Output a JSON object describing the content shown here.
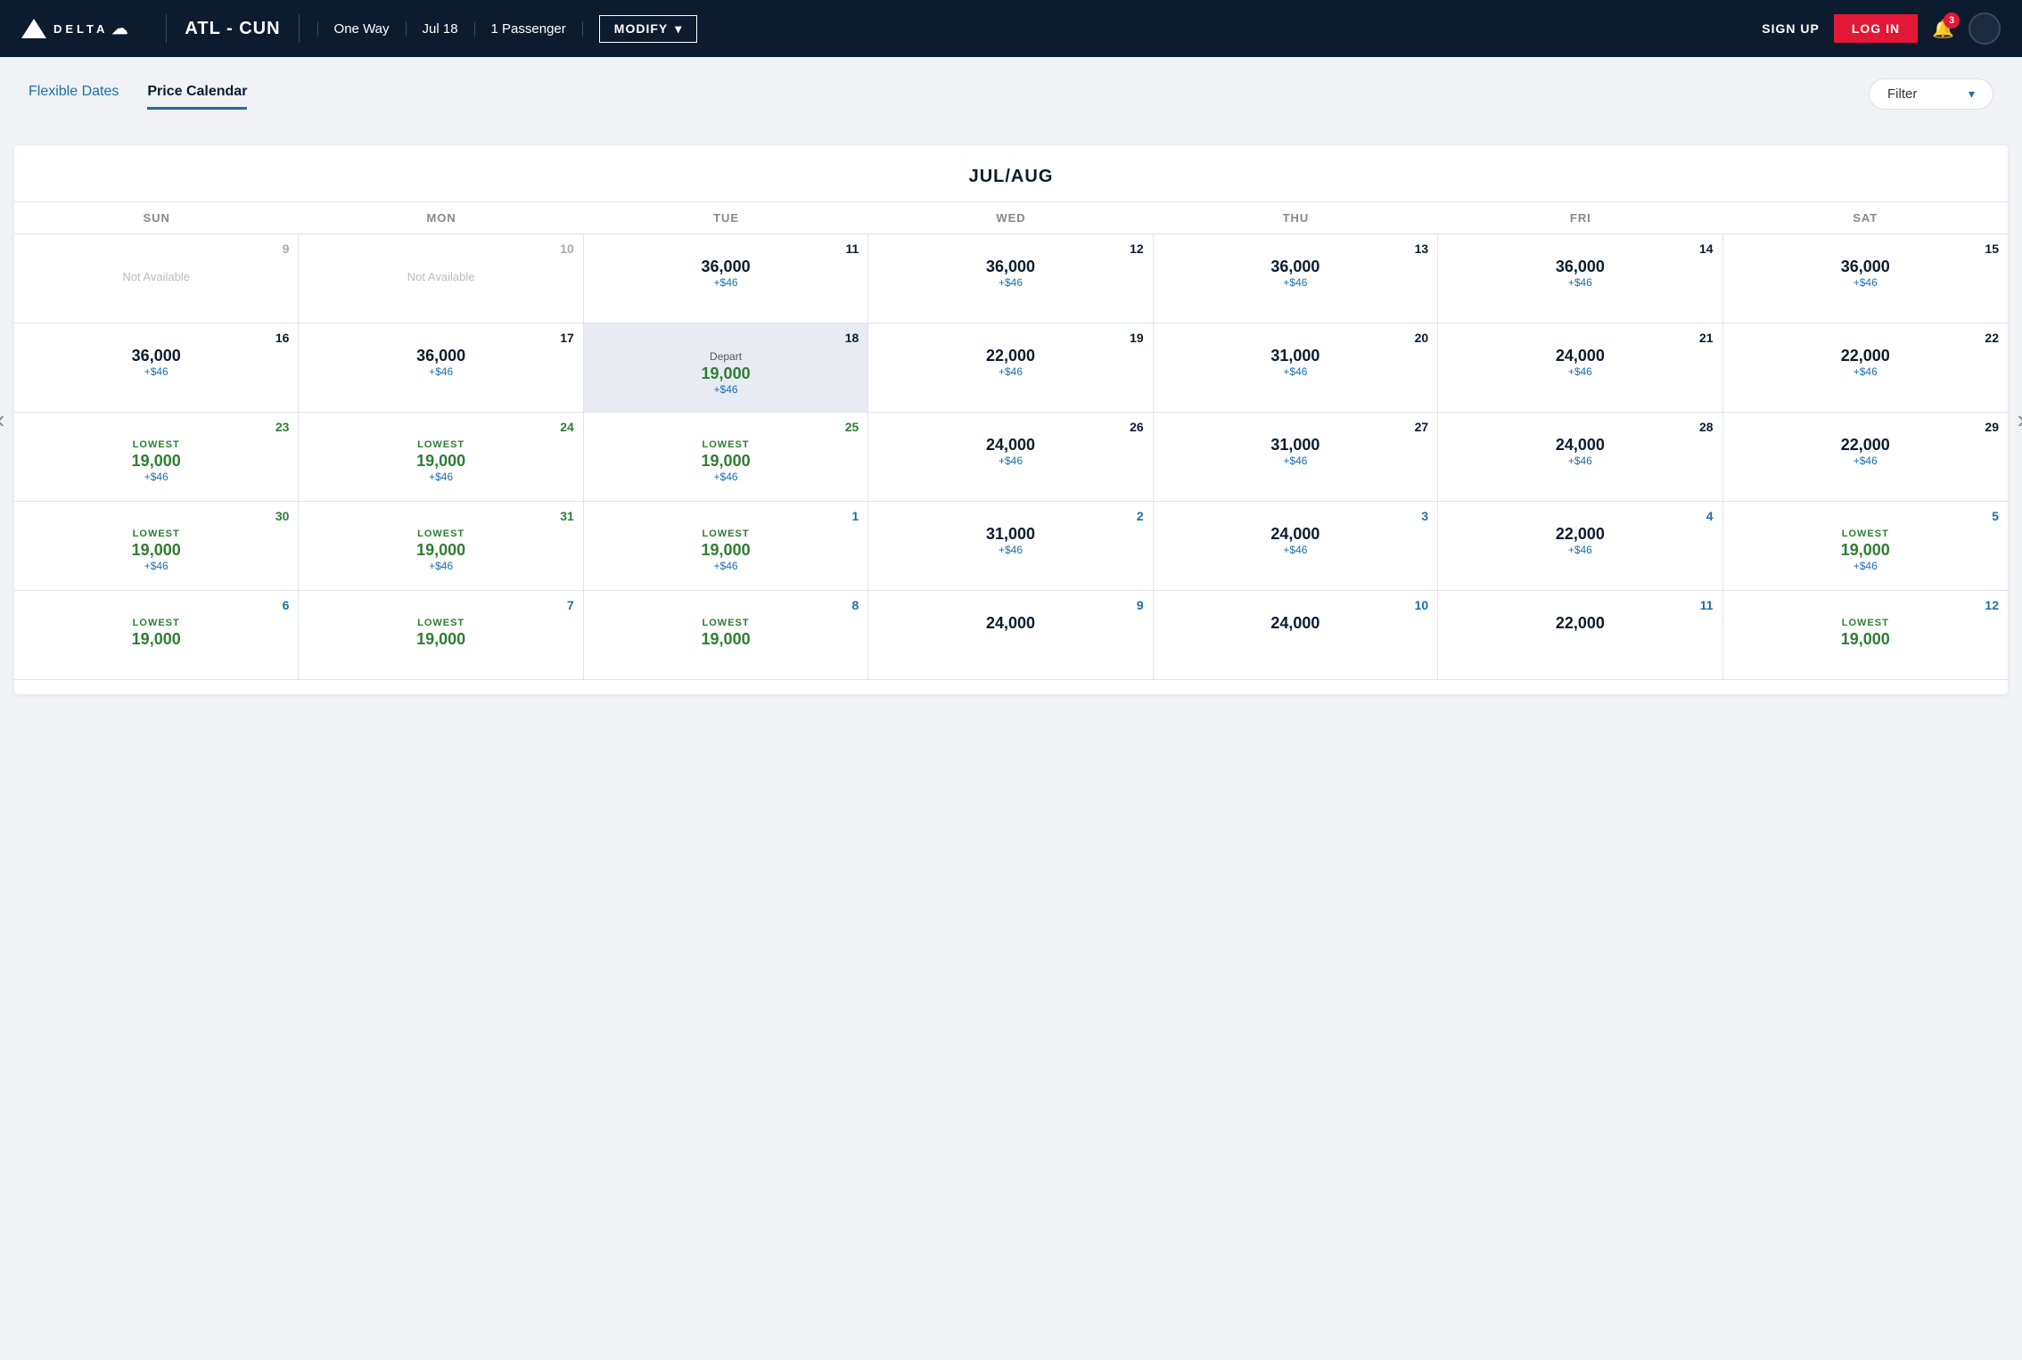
{
  "header": {
    "logo_text": "DELTA",
    "route": "ATL - CUN",
    "trip_type": "One Way",
    "date": "Jul 18",
    "passengers": "1 Passenger",
    "modify_label": "MODIFY",
    "signup_label": "SIGN UP",
    "login_label": "LOG IN",
    "notif_count": "3"
  },
  "tabs": {
    "flexible_dates": "Flexible Dates",
    "price_calendar": "Price Calendar"
  },
  "filter": {
    "label": "Filter"
  },
  "calendar": {
    "month_title": "JUL/AUG",
    "day_headers": [
      "SUN",
      "MON",
      "TUE",
      "WED",
      "THU",
      "FRI",
      "SAT"
    ],
    "rows": [
      [
        {
          "date": "9",
          "date_style": "gray",
          "status": "na",
          "na_text": "Not Available"
        },
        {
          "date": "10",
          "date_style": "gray",
          "status": "na",
          "na_text": "Not Available"
        },
        {
          "date": "11",
          "date_style": "normal",
          "status": "price",
          "price": "36,000",
          "tax": "+$46"
        },
        {
          "date": "12",
          "date_style": "normal",
          "status": "price",
          "price": "36,000",
          "tax": "+$46"
        },
        {
          "date": "13",
          "date_style": "normal",
          "status": "price",
          "price": "36,000",
          "tax": "+$46"
        },
        {
          "date": "14",
          "date_style": "normal",
          "status": "price",
          "price": "36,000",
          "tax": "+$46"
        },
        {
          "date": "15",
          "date_style": "normal",
          "status": "price",
          "price": "36,000",
          "tax": "+$46"
        }
      ],
      [
        {
          "date": "16",
          "date_style": "normal",
          "status": "price",
          "price": "36,000",
          "tax": "+$46"
        },
        {
          "date": "17",
          "date_style": "normal",
          "status": "price",
          "price": "36,000",
          "tax": "+$46"
        },
        {
          "date": "18",
          "date_style": "normal",
          "status": "depart",
          "depart_label": "Depart",
          "price": "19,000",
          "tax": "+$46"
        },
        {
          "date": "19",
          "date_style": "normal",
          "status": "price",
          "price": "22,000",
          "tax": "+$46"
        },
        {
          "date": "20",
          "date_style": "normal",
          "status": "price",
          "price": "31,000",
          "tax": "+$46"
        },
        {
          "date": "21",
          "date_style": "normal",
          "status": "price",
          "price": "24,000",
          "tax": "+$46"
        },
        {
          "date": "22",
          "date_style": "normal",
          "status": "price",
          "price": "22,000",
          "tax": "+$46"
        }
      ],
      [
        {
          "date": "23",
          "date_style": "green",
          "status": "lowest",
          "lowest_label": "LOWEST",
          "price": "19,000",
          "tax": "+$46"
        },
        {
          "date": "24",
          "date_style": "green",
          "status": "lowest",
          "lowest_label": "LOWEST",
          "price": "19,000",
          "tax": "+$46"
        },
        {
          "date": "25",
          "date_style": "green",
          "status": "lowest",
          "lowest_label": "LOWEST",
          "price": "19,000",
          "tax": "+$46"
        },
        {
          "date": "26",
          "date_style": "normal",
          "status": "price",
          "price": "24,000",
          "tax": "+$46"
        },
        {
          "date": "27",
          "date_style": "normal",
          "status": "price",
          "price": "31,000",
          "tax": "+$46"
        },
        {
          "date": "28",
          "date_style": "normal",
          "status": "price",
          "price": "24,000",
          "tax": "+$46"
        },
        {
          "date": "29",
          "date_style": "normal",
          "status": "price",
          "price": "22,000",
          "tax": "+$46"
        }
      ],
      [
        {
          "date": "30",
          "date_style": "green",
          "status": "lowest",
          "lowest_label": "LOWEST",
          "price": "19,000",
          "tax": "+$46"
        },
        {
          "date": "31",
          "date_style": "green",
          "status": "lowest",
          "lowest_label": "LOWEST",
          "price": "19,000",
          "tax": "+$46"
        },
        {
          "date": "1",
          "date_style": "aug",
          "status": "lowest",
          "lowest_label": "LOWEST",
          "price": "19,000",
          "tax": "+$46"
        },
        {
          "date": "2",
          "date_style": "aug",
          "status": "price",
          "price": "31,000",
          "tax": "+$46"
        },
        {
          "date": "3",
          "date_style": "aug",
          "status": "price",
          "price": "24,000",
          "tax": "+$46"
        },
        {
          "date": "4",
          "date_style": "aug",
          "status": "price",
          "price": "22,000",
          "tax": "+$46"
        },
        {
          "date": "5",
          "date_style": "aug-green",
          "status": "lowest",
          "lowest_label": "LOWEST",
          "price": "19,000",
          "tax": "+$46"
        }
      ],
      [
        {
          "date": "6",
          "date_style": "aug-green",
          "status": "lowest",
          "lowest_label": "LOWEST",
          "price": "19,000",
          "tax": ""
        },
        {
          "date": "7",
          "date_style": "aug-green",
          "status": "lowest",
          "lowest_label": "LOWEST",
          "price": "19,000",
          "tax": ""
        },
        {
          "date": "8",
          "date_style": "aug-green",
          "status": "lowest",
          "lowest_label": "LOWEST",
          "price": "19,000",
          "tax": ""
        },
        {
          "date": "9",
          "date_style": "aug",
          "status": "price",
          "price": "24,000",
          "tax": ""
        },
        {
          "date": "10",
          "date_style": "aug",
          "status": "price",
          "price": "24,000",
          "tax": ""
        },
        {
          "date": "11",
          "date_style": "aug",
          "status": "price",
          "price": "22,000",
          "tax": ""
        },
        {
          "date": "12",
          "date_style": "aug-green",
          "status": "lowest",
          "lowest_label": "LOWEST",
          "price": "19,000",
          "tax": ""
        }
      ]
    ]
  }
}
